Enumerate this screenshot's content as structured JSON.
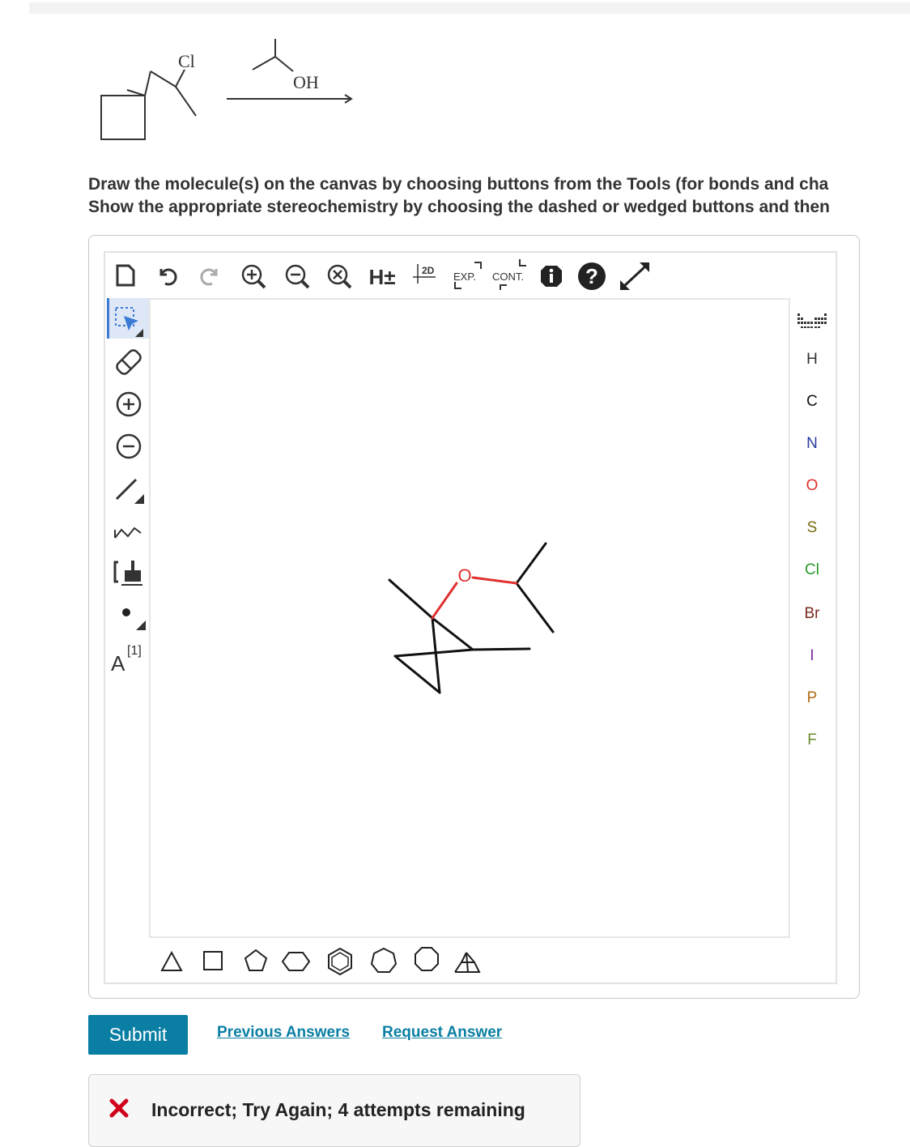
{
  "reaction": {
    "reactant_label": "Cl",
    "reagent_label": "OH"
  },
  "instructions": {
    "line1": "Draw the molecule(s) on the canvas by choosing buttons from the Tools (for bonds and cha",
    "line2": "Show the appropriate stereochemistry by choosing the dashed or wedged buttons and then"
  },
  "toolbar": {
    "h_label": "H±",
    "clean2d_label": "2D",
    "expand_label": "EXP.",
    "contract_label": "CONT."
  },
  "left_tools": {
    "charge_index_label": "[1]",
    "atom_map_label": "A"
  },
  "canvas": {
    "oxygen_label": "O"
  },
  "atoms": [
    {
      "symbol": "H",
      "color": "#333333"
    },
    {
      "symbol": "C",
      "color": "#111111"
    },
    {
      "symbol": "N",
      "color": "#2a3a9e"
    },
    {
      "symbol": "O",
      "color": "#e03030"
    },
    {
      "symbol": "S",
      "color": "#7a6a10"
    },
    {
      "symbol": "Cl",
      "color": "#2a9a2a"
    },
    {
      "symbol": "Br",
      "color": "#7a2a20"
    },
    {
      "symbol": "I",
      "color": "#7a2a9e"
    },
    {
      "symbol": "P",
      "color": "#b06a10"
    },
    {
      "symbol": "F",
      "color": "#6a8a2a"
    }
  ],
  "actions": {
    "submit": "Submit",
    "previous_answers": "Previous Answers",
    "request_answer": "Request Answer"
  },
  "feedback": {
    "message": "Incorrect; Try Again; 4 attempts remaining"
  },
  "colors": {
    "accent": "#0a7fa3",
    "error": "#d0021b",
    "selected_tool": "#3b7bd6"
  }
}
